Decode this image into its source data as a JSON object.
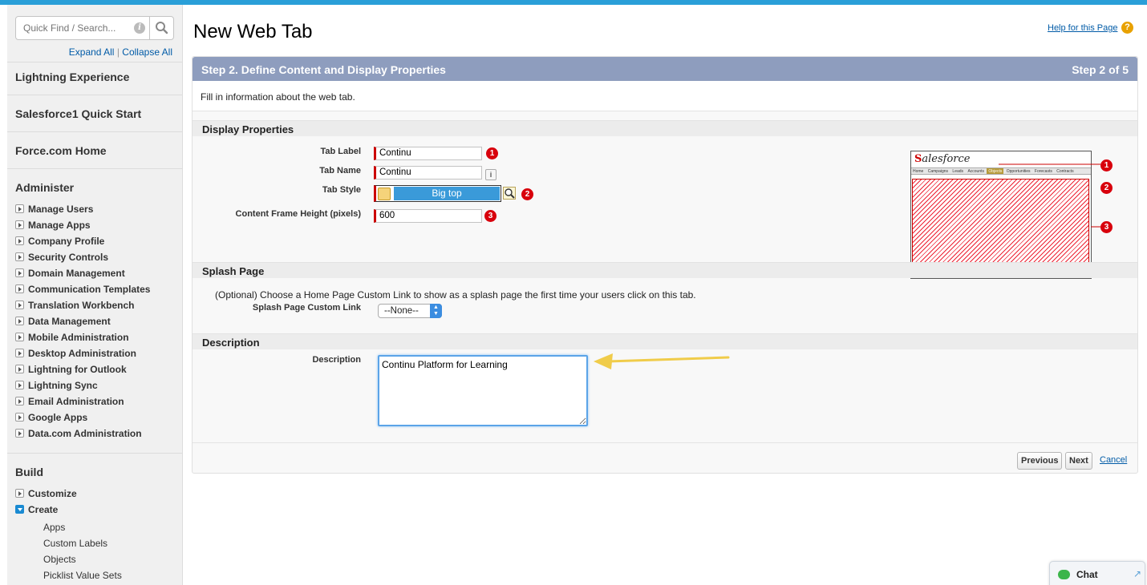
{
  "sidebar": {
    "search_placeholder": "Quick Find / Search...",
    "expand_all": "Expand All",
    "separator": "|",
    "collapse_all": "Collapse All",
    "top_links": [
      "Lightning Experience",
      "Salesforce1 Quick Start",
      "Force.com Home"
    ],
    "administer_heading": "Administer",
    "administer_items": [
      "Manage Users",
      "Manage Apps",
      "Company Profile",
      "Security Controls",
      "Domain Management",
      "Communication Templates",
      "Translation Workbench",
      "Data Management",
      "Mobile Administration",
      "Desktop Administration",
      "Lightning for Outlook",
      "Lightning Sync",
      "Email Administration",
      "Google Apps",
      "Data.com Administration"
    ],
    "build_heading": "Build",
    "build_items": [
      "Customize",
      "Create"
    ],
    "create_subitems": [
      "Apps",
      "Custom Labels",
      "Objects",
      "Picklist Value Sets"
    ]
  },
  "header": {
    "title": "New Web Tab",
    "help_link": "Help for this Page",
    "help_icon": "?"
  },
  "step": {
    "title": "Step 2. Define Content and Display Properties",
    "progress": "Step 2 of 5",
    "intro": "Fill in information about the web tab."
  },
  "display": {
    "heading": "Display Properties",
    "tab_label_label": "Tab Label",
    "tab_label_value": "Continu",
    "tab_name_label": "Tab Name",
    "tab_name_value": "Continu",
    "tab_name_info": "i",
    "tab_style_label": "Tab Style",
    "tab_style_value": "Big top",
    "frame_height_label": "Content Frame Height (pixels)",
    "frame_height_value": "600",
    "markers": [
      "1",
      "2",
      "3"
    ]
  },
  "preview": {
    "logo": "alesforce",
    "logo_s": "S",
    "nav": [
      "Home",
      "Campaigns",
      "Leads",
      "Accounts",
      "Objects",
      "Opportunities",
      "Forecasts",
      "Contracts"
    ]
  },
  "splash": {
    "heading": "Splash Page",
    "text": "(Optional) Choose a Home Page Custom Link to show as a splash page the first time your users click on this tab.",
    "link_label": "Splash Page Custom Link",
    "link_value": "--None--"
  },
  "description": {
    "heading": "Description",
    "label": "Description",
    "value": "Continu Platform for Learning"
  },
  "buttons": {
    "previous": "Previous",
    "next": "Next",
    "cancel": "Cancel"
  },
  "chat": {
    "label": "Chat"
  },
  "colors": {
    "step_bar": "#8e9dbe",
    "required": "#cc0000",
    "marker": "#d8000c",
    "arrow": "#f0cc4a",
    "link": "#015ba7"
  }
}
